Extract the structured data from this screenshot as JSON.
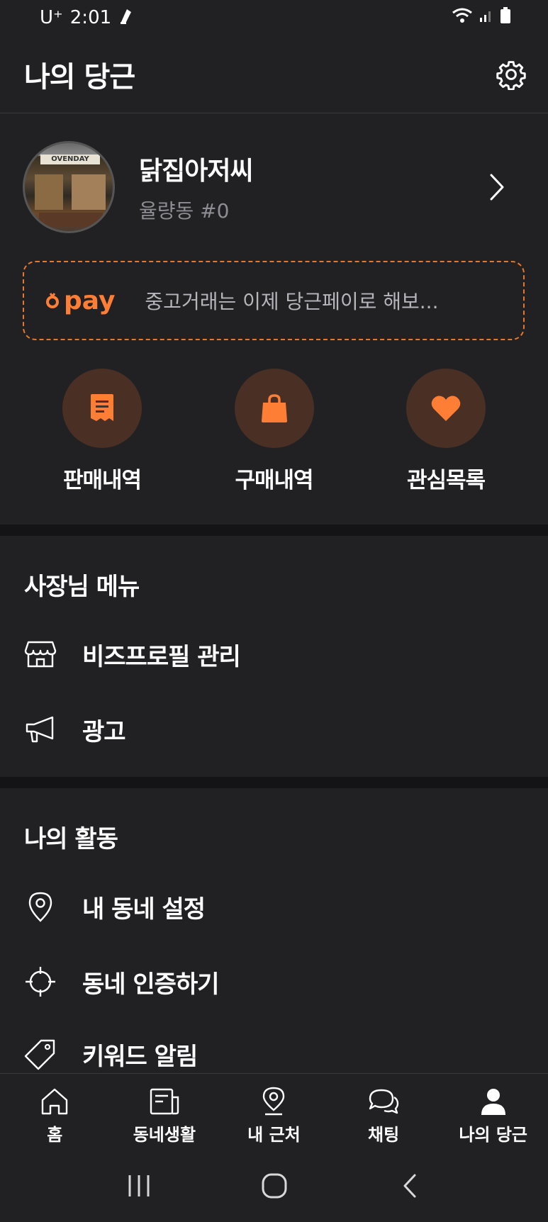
{
  "status_bar": {
    "carrier": "U⁺",
    "time": "2:01"
  },
  "header": {
    "title": "나의 당근"
  },
  "profile": {
    "name": "닭집아저씨",
    "subtitle": "율량동 #0",
    "avatar_sign": "OVENDAY"
  },
  "pay_banner": {
    "logo_text": "pay",
    "message": "중고거래는 이제 당근페이로 해보..."
  },
  "quick_actions": [
    {
      "label": "판매내역",
      "icon": "receipt-icon"
    },
    {
      "label": "구매내역",
      "icon": "shopping-bag-icon"
    },
    {
      "label": "관심목록",
      "icon": "heart-icon"
    }
  ],
  "boss_menu": {
    "title": "사장님 메뉴",
    "items": [
      {
        "label": "비즈프로필 관리",
        "icon": "storefront-icon"
      },
      {
        "label": "광고",
        "icon": "megaphone-icon"
      }
    ]
  },
  "my_activity": {
    "title": "나의 활동",
    "items": [
      {
        "label": "내 동네 설정",
        "icon": "location-pin-icon"
      },
      {
        "label": "동네 인증하기",
        "icon": "crosshair-icon"
      },
      {
        "label": "키워드 알림",
        "icon": "tag-icon"
      }
    ]
  },
  "bottom_nav": [
    {
      "label": "홈",
      "icon": "home-icon"
    },
    {
      "label": "동네생활",
      "icon": "newspaper-icon"
    },
    {
      "label": "내 근처",
      "icon": "map-pin-icon"
    },
    {
      "label": "채팅",
      "icon": "chat-bubbles-icon"
    },
    {
      "label": "나의 당근",
      "icon": "person-icon",
      "active": true
    }
  ],
  "colors": {
    "accent": "#ff7e36",
    "background": "#212123",
    "muted_text": "#8d8d93"
  }
}
